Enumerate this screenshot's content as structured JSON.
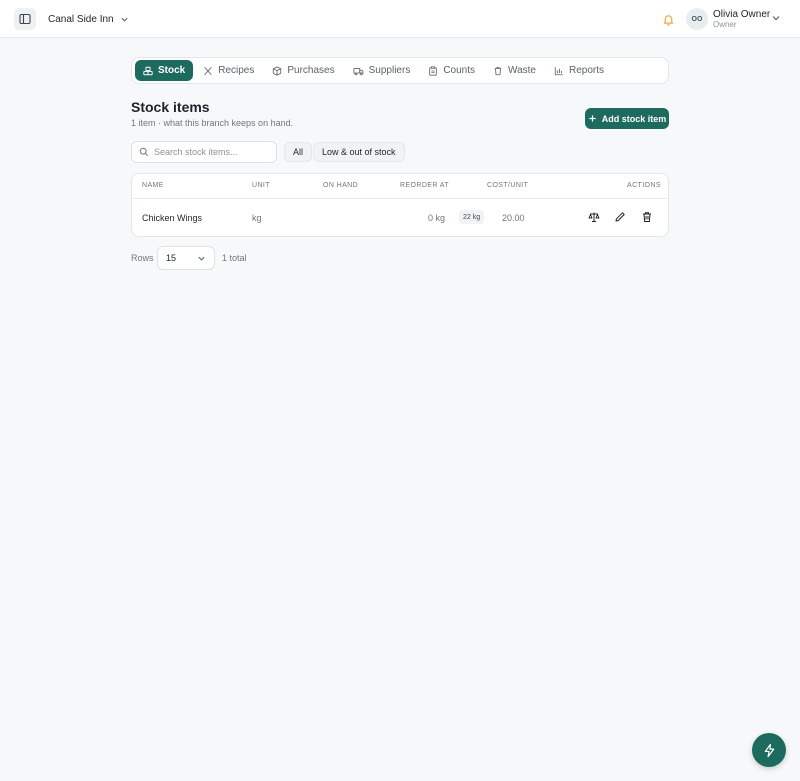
{
  "header": {
    "branch": "Canal Side Inn",
    "user": {
      "name": "Olivia Owner",
      "role": "Owner",
      "initials": "OO"
    }
  },
  "tabs": [
    {
      "label": "Stock",
      "icon": "boxes-icon",
      "active": true
    },
    {
      "label": "Recipes",
      "icon": "utensils-icon"
    },
    {
      "label": "Purchases",
      "icon": "package-icon"
    },
    {
      "label": "Suppliers",
      "icon": "truck-icon"
    },
    {
      "label": "Counts",
      "icon": "clipboard-icon"
    },
    {
      "label": "Waste",
      "icon": "trash-icon"
    },
    {
      "label": "Reports",
      "icon": "bar-chart-icon"
    }
  ],
  "page": {
    "title": "Stock items",
    "subtitle": "1 item · what this branch keeps on hand.",
    "add_label": "Add stock item"
  },
  "search": {
    "placeholder": "Search stock items..."
  },
  "filters": {
    "all": "All",
    "low": "Low & out of stock"
  },
  "table": {
    "columns": {
      "name": "Name",
      "unit": "Unit",
      "on_hand": "On hand",
      "reorder_at": "Reorder at",
      "cost_unit": "Cost/Unit",
      "actions": "Actions"
    },
    "rows": [
      {
        "name": "Chicken Wings",
        "unit": "kg",
        "on_hand": "22 kg",
        "reorder_at": "0 kg",
        "cost_unit": "20.00"
      }
    ]
  },
  "pagination": {
    "rows_label": "Rows",
    "rows_value": "15",
    "total": "1 total"
  },
  "colors": {
    "accent": "#1d6b5f",
    "bell": "#f0a23a"
  }
}
